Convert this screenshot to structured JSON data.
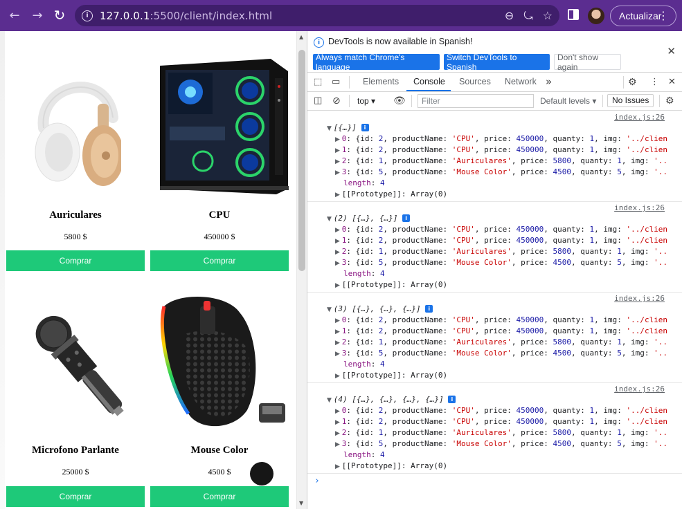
{
  "browser": {
    "url_host": "127.0.0.1",
    "url_path": ":5500/client/index.html",
    "update_label": "Actualizar",
    "colors": {
      "frame": "#5b2d90",
      "omnibox": "#3f1e6b"
    }
  },
  "page": {
    "products": [
      {
        "name": "Auriculares",
        "price": "5800 $",
        "button": "Comprar",
        "image": "headphones-image"
      },
      {
        "name": "CPU",
        "price": "450000 $",
        "button": "Comprar",
        "image": "gaming-pc-image"
      },
      {
        "name": "Microfono Parlante",
        "price": "25000 $",
        "button": "Comprar",
        "image": "microphone-image"
      },
      {
        "name": "Mouse Color",
        "price": "4500 $",
        "button": "Comprar",
        "image": "gaming-mouse-image"
      }
    ],
    "button_color": "#1ec979"
  },
  "devtools": {
    "notice": {
      "message": "DevTools is now available in Spanish!",
      "btn_match": "Always match Chrome's language",
      "btn_switch": "Switch DevTools to Spanish",
      "btn_dismiss": "Don't show again"
    },
    "tabs": [
      "Elements",
      "Console",
      "Sources",
      "Network"
    ],
    "active_tab": "Console",
    "filterbar": {
      "context": "top",
      "filter_placeholder": "Filter",
      "levels": "Default levels",
      "issues": "No Issues"
    },
    "console": {
      "source": "index.js:26",
      "entries": [
        {
          "head": "[{…}]"
        },
        {
          "head": "(2) [{…}, {…}]"
        },
        {
          "head": "(3) [{…}, {…}, {…}]"
        },
        {
          "head": "(4) [{…}, {…}, {…}, {…}]"
        }
      ],
      "rows": [
        {
          "idx": "0",
          "id": "2",
          "productName": "'CPU'",
          "price": "450000",
          "quanty": "1",
          "img": "'../clien"
        },
        {
          "idx": "1",
          "id": "2",
          "productName": "'CPU'",
          "price": "450000",
          "quanty": "1",
          "img": "'../clien"
        },
        {
          "idx": "2",
          "id": "1",
          "productName": "'Auriculares'",
          "price": "5800",
          "quanty": "1",
          "img": "'.."
        },
        {
          "idx": "3",
          "id": "5",
          "productName": "'Mouse Color'",
          "price": "4500",
          "quanty": "5",
          "img": "'.."
        }
      ],
      "length_label": "length",
      "length_value": "4",
      "prototype": "[[Prototype]]: Array(0)"
    }
  }
}
